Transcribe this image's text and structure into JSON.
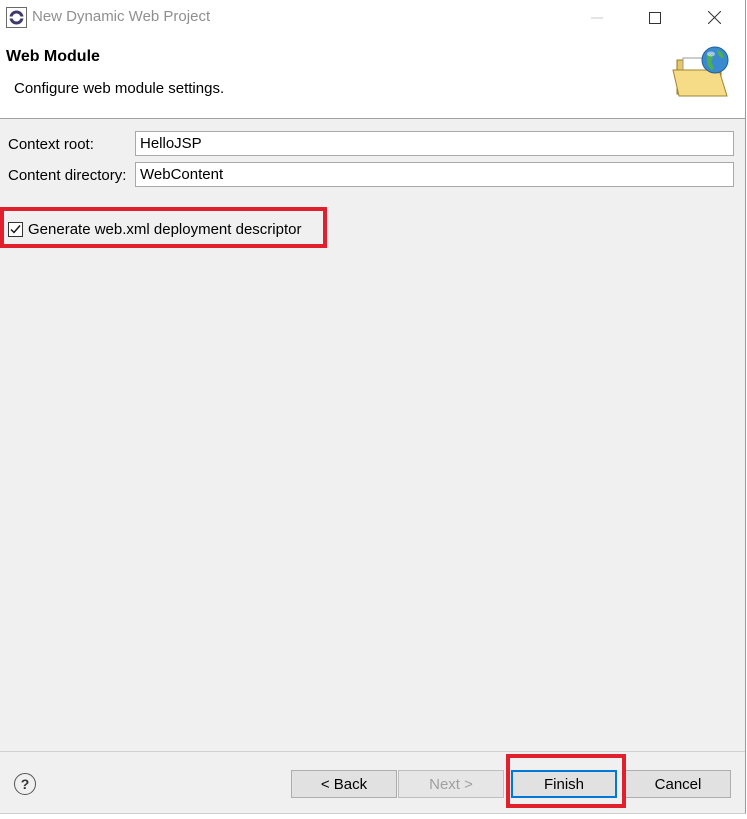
{
  "window": {
    "title": "New Dynamic Web Project"
  },
  "header": {
    "title": "Web Module",
    "description": "Configure web module settings.",
    "icon": "folder-globe-icon"
  },
  "form": {
    "context_root_label": "Context root:",
    "context_root_value": "HelloJSP",
    "content_dir_label": "Content directory:",
    "content_dir_value": "WebContent",
    "generate_descriptor_label": "Generate web.xml deployment descriptor",
    "generate_descriptor_checked": true
  },
  "buttons": {
    "help": "?",
    "back": "< Back",
    "next": "Next >",
    "finish": "Finish",
    "cancel": "Cancel"
  },
  "colors": {
    "highlight": "#e0202c",
    "default_button_border": "#0078d7",
    "dialog_background": "#f0f0f0"
  }
}
